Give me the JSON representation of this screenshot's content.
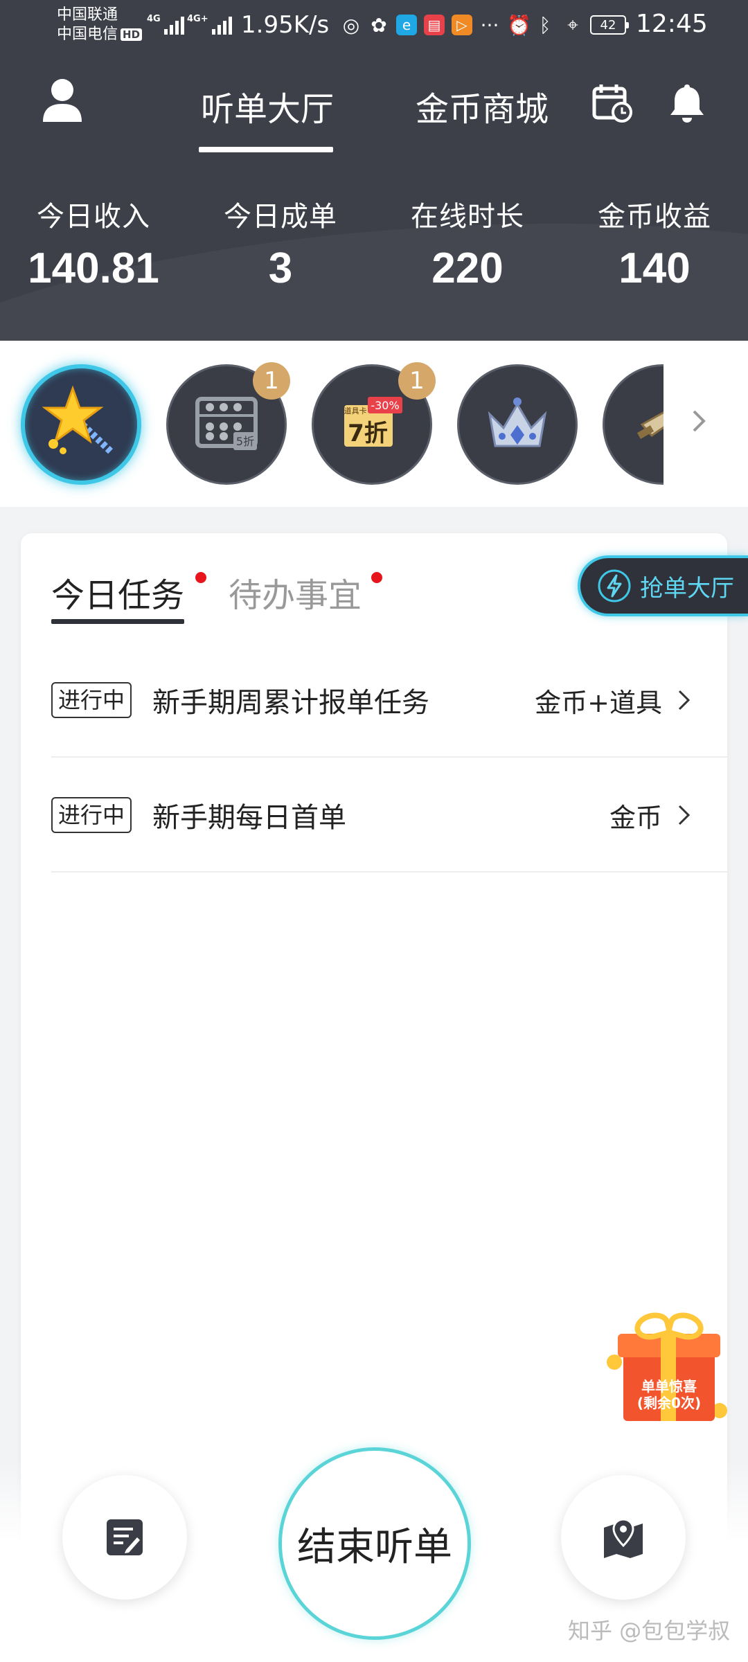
{
  "status_bar": {
    "carrier_1": "中国联通",
    "carrier_2": "中国电信",
    "hd": "HD",
    "net_tag_1": "4G",
    "net_tag_2": "4G+",
    "speed": "1.95K/s",
    "icons": [
      "netease-music-icon",
      "wechat-icon",
      "browser-icon",
      "reader-icon",
      "video-icon",
      "more-icon",
      "alarm-icon",
      "bluetooth-icon",
      "location-icon"
    ],
    "more": "···",
    "battery": "42",
    "time": "12:45"
  },
  "header": {
    "tab_active": "听单大厅",
    "tab_shop": "金币商城",
    "icons": [
      "profile-icon",
      "calendar-clock-icon",
      "bell-icon"
    ]
  },
  "stats": [
    {
      "label": "今日收入",
      "value": "140.81"
    },
    {
      "label": "今日成单",
      "value": "3"
    },
    {
      "label": "在线时长",
      "value": "220"
    },
    {
      "label": "金币收益",
      "value": "140"
    }
  ],
  "items": [
    {
      "icon": "magic-wand-star-icon",
      "active": true,
      "badge": ""
    },
    {
      "icon": "abacus-discount-icon",
      "active": false,
      "badge": "1",
      "caption": "5折"
    },
    {
      "icon": "discount-card-icon",
      "active": false,
      "badge": "1",
      "caption": "7折",
      "tag": "-30%",
      "mini": "道具卡"
    },
    {
      "icon": "crown-icon",
      "active": false,
      "badge": ""
    },
    {
      "icon": "sword-icon",
      "active": false,
      "badge": ""
    }
  ],
  "tasks": {
    "tab_today": "今日任务",
    "tab_todo": "待办事宜",
    "grab_button": "抢单大厅",
    "rows": [
      {
        "status": "进行中",
        "title": "新手期周累计报单任务",
        "reward": "金币+道具"
      },
      {
        "status": "进行中",
        "title": "新手期每日首单",
        "reward": "金币"
      }
    ]
  },
  "gift": {
    "line1": "单单惊喜",
    "line2": "(剩余0次)"
  },
  "bottom": {
    "end_button": "结束听单",
    "left_icon": "edit-note-icon",
    "right_icon": "map-pin-icon"
  },
  "watermark": "知乎 @包包学叔",
  "colors": {
    "header_bg": "#3d4048",
    "accent_cyan": "#3ec7e6",
    "badge_gold": "#d5a86a",
    "dot_red": "#e8141b"
  }
}
